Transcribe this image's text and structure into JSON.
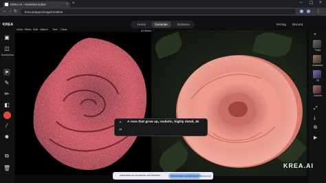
{
  "browser": {
    "tab_title": "KREA AI - Realtime Editor",
    "tab_close": "×",
    "new_tab": "+",
    "url": "krea.ai/apps/image/realtime",
    "window_controls": [
      "–",
      "☐",
      "×"
    ]
  },
  "app": {
    "logo": "KREA",
    "modes": [
      "Home",
      "Generate",
      "Enhance"
    ],
    "active_mode": "Generate",
    "top_links": [
      "Pricing",
      "Discord"
    ],
    "toolbar_items": [
      "Undo",
      "Redo",
      "Add",
      "Object",
      "Text",
      "Clear"
    ],
    "strength_label": "AI Strength",
    "strength_value": 0.6,
    "left_sidebar": {
      "top_label": "Screenshot"
    },
    "prompt": "A rose that grow up, realistic, highly detail, 4k",
    "right_sidebar": {
      "styles": [
        "Photo",
        "Illustration",
        "3D",
        "Cartoon"
      ]
    },
    "watermark": "KREA.AI"
  },
  "screen_share": {
    "message": "www.krea.ai condivide una finestra.",
    "stop_button": "Interrompi condivisione",
    "hide_button": "Nascondi"
  },
  "colors": {
    "accent_red": "#e4473b",
    "rose_pink": "#e2897c",
    "noisy_rose": "#c63a48"
  }
}
